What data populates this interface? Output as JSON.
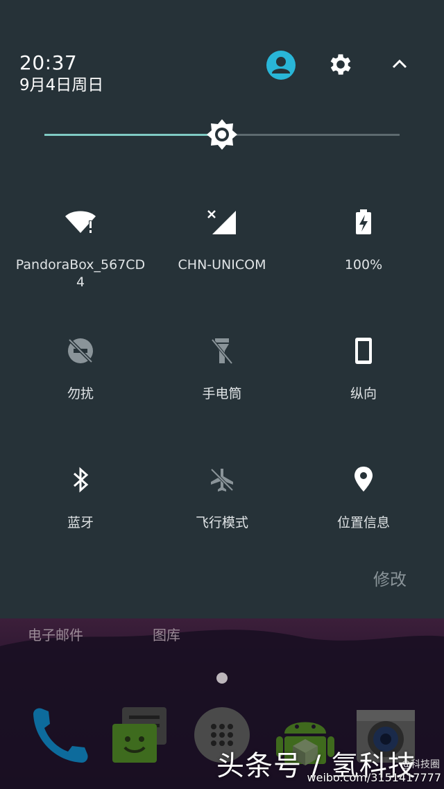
{
  "header": {
    "time": "20:37",
    "date": "9月4日周日"
  },
  "brightness": {
    "level_fraction": 0.5
  },
  "tiles": [
    {
      "label": "PandoraBox_567CD4",
      "icon": "wifi-icon"
    },
    {
      "label": "CHN-UNICOM",
      "icon": "cellular-signal-icon"
    },
    {
      "label": "100%",
      "icon": "battery-charging-icon"
    },
    {
      "label": "勿扰",
      "icon": "do-not-disturb-off-icon"
    },
    {
      "label": "手电筒",
      "icon": "flashlight-off-icon"
    },
    {
      "label": "纵向",
      "icon": "portrait-orientation-icon"
    },
    {
      "label": "蓝牙",
      "icon": "bluetooth-icon"
    },
    {
      "label": "飞行模式",
      "icon": "airplane-mode-icon"
    },
    {
      "label": "位置信息",
      "icon": "location-icon"
    }
  ],
  "edit_label": "修改",
  "home": {
    "labels": [
      "电子邮件",
      "图库"
    ],
    "dock": [
      "phone-icon",
      "messaging-icon",
      "app-drawer-icon",
      "android-store-icon",
      "camera-icon"
    ]
  },
  "watermark": {
    "text": "头条号 / 氢科技",
    "weibo": "weibo.com/3151417777",
    "weibo_small": "@科技圈"
  },
  "colors": {
    "panel_bg": "#263238",
    "accent": "#80cbc4",
    "user_icon": "#29b6d8"
  }
}
